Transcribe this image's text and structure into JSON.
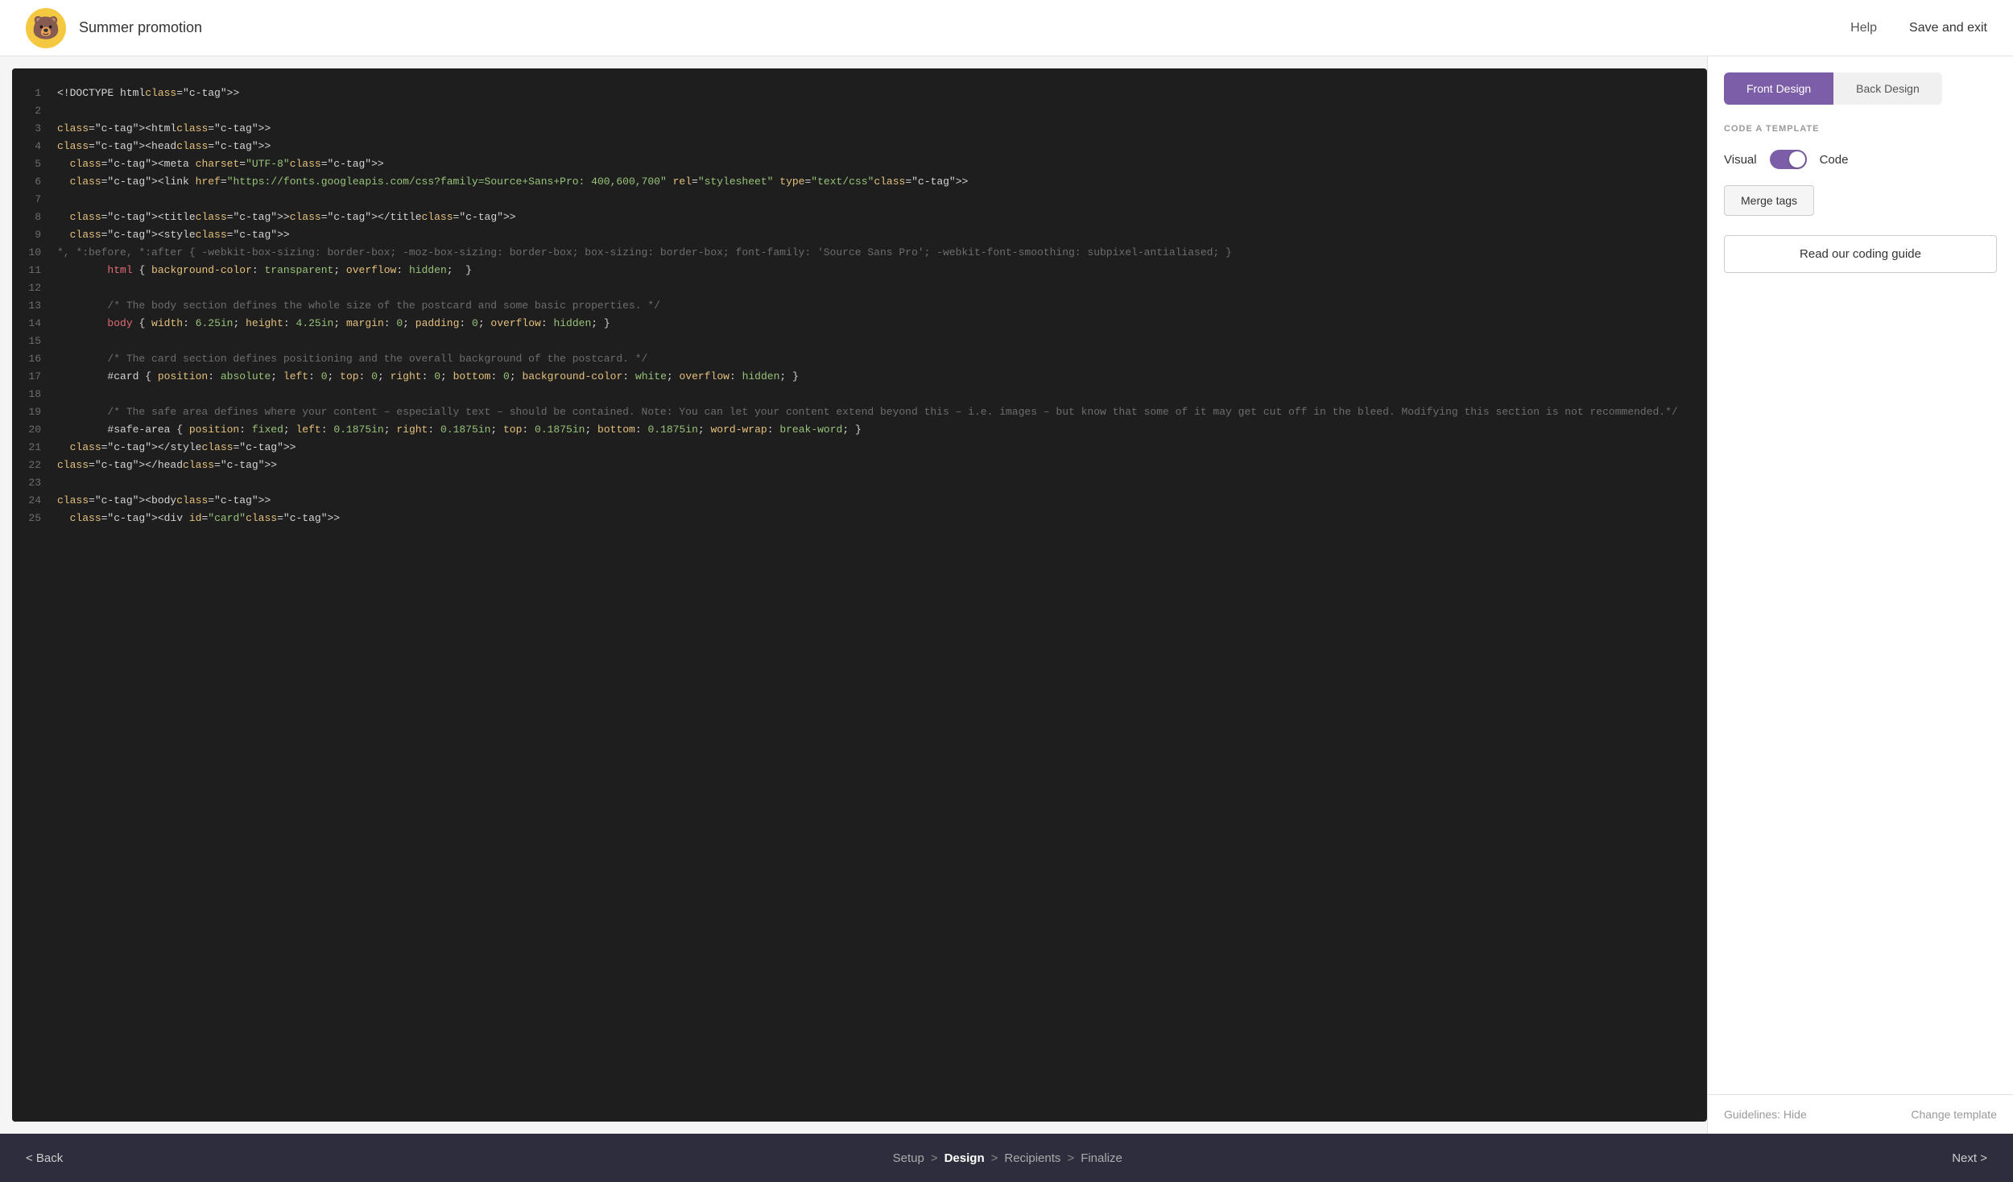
{
  "header": {
    "title": "Summer promotion",
    "help_label": "Help",
    "save_label": "Save and exit",
    "logo_icon": "🐻"
  },
  "tabs": {
    "front_label": "Front Design",
    "back_label": "Back Design"
  },
  "panel": {
    "section_label": "CODE A TEMPLATE",
    "toggle_visual": "Visual",
    "toggle_code": "Code",
    "merge_tags_label": "Merge tags",
    "coding_guide_label": "Read our coding guide",
    "guidelines_label": "Guidelines: Hide",
    "change_template_label": "Change template"
  },
  "nav": {
    "back_label": "< Back",
    "step_setup": "Setup",
    "step_design": "Design",
    "step_recipients": "Recipients",
    "step_finalize": "Finalize",
    "next_label": "Next >"
  },
  "code_lines": [
    {
      "num": 1,
      "content": "<!DOCTYPE html>"
    },
    {
      "num": 2,
      "content": ""
    },
    {
      "num": 3,
      "content": "<html>"
    },
    {
      "num": 4,
      "content": "<head>"
    },
    {
      "num": 5,
      "content": "  <meta charset=\"UTF-8\">"
    },
    {
      "num": 6,
      "content": "  <link href=\"https://fonts.googleapis.com/css?family=Source+Sans+Pro:400,600,700\" rel=\"stylesheet\" type=\"text/css\">"
    },
    {
      "num": 7,
      "content": ""
    },
    {
      "num": 8,
      "content": "  <title></title>"
    },
    {
      "num": 9,
      "content": "  <style>"
    },
    {
      "num": 10,
      "content": "*, *:before, *:after { -webkit-box-sizing: border-box; -moz-box-sizing: border-box; box-sizing: border-box; font-family: 'Source Sans Pro'; -webkit-font-smoothing: subpixel-antialiased; }"
    },
    {
      "num": 11,
      "content": "        html { background-color: transparent; overflow: hidden;  }"
    },
    {
      "num": 12,
      "content": ""
    },
    {
      "num": 13,
      "content": "        /* The body section defines the whole size of the postcard and some basic properties. */"
    },
    {
      "num": 14,
      "content": "        body { width: 6.25in; height: 4.25in; margin: 0; padding: 0; overflow: hidden; }"
    },
    {
      "num": 15,
      "content": ""
    },
    {
      "num": 16,
      "content": "        /* The card section defines positioning and the overall background of the postcard. */"
    },
    {
      "num": 17,
      "content": "        #card { position: absolute; left: 0; top: 0; right: 0; bottom: 0; background-color: white; overflow: hidden; }"
    },
    {
      "num": 18,
      "content": ""
    },
    {
      "num": 19,
      "content": "        /* The safe area defines where your content – especially text – should be contained. Note: You can let your content extend beyond this – i.e. images – but know that some of it may get cut off in the bleed. Modifying this section is not recommended.*/"
    },
    {
      "num": 20,
      "content": "        #safe-area { position: fixed; left: 0.1875in; right: 0.1875in; top: 0.1875in; bottom: 0.1875in; word-wrap: break-word; }"
    },
    {
      "num": 21,
      "content": "  </style>"
    },
    {
      "num": 22,
      "content": "</head>"
    },
    {
      "num": 23,
      "content": ""
    },
    {
      "num": 24,
      "content": "<body>"
    },
    {
      "num": 25,
      "content": "  <div id=\"card\">"
    }
  ]
}
